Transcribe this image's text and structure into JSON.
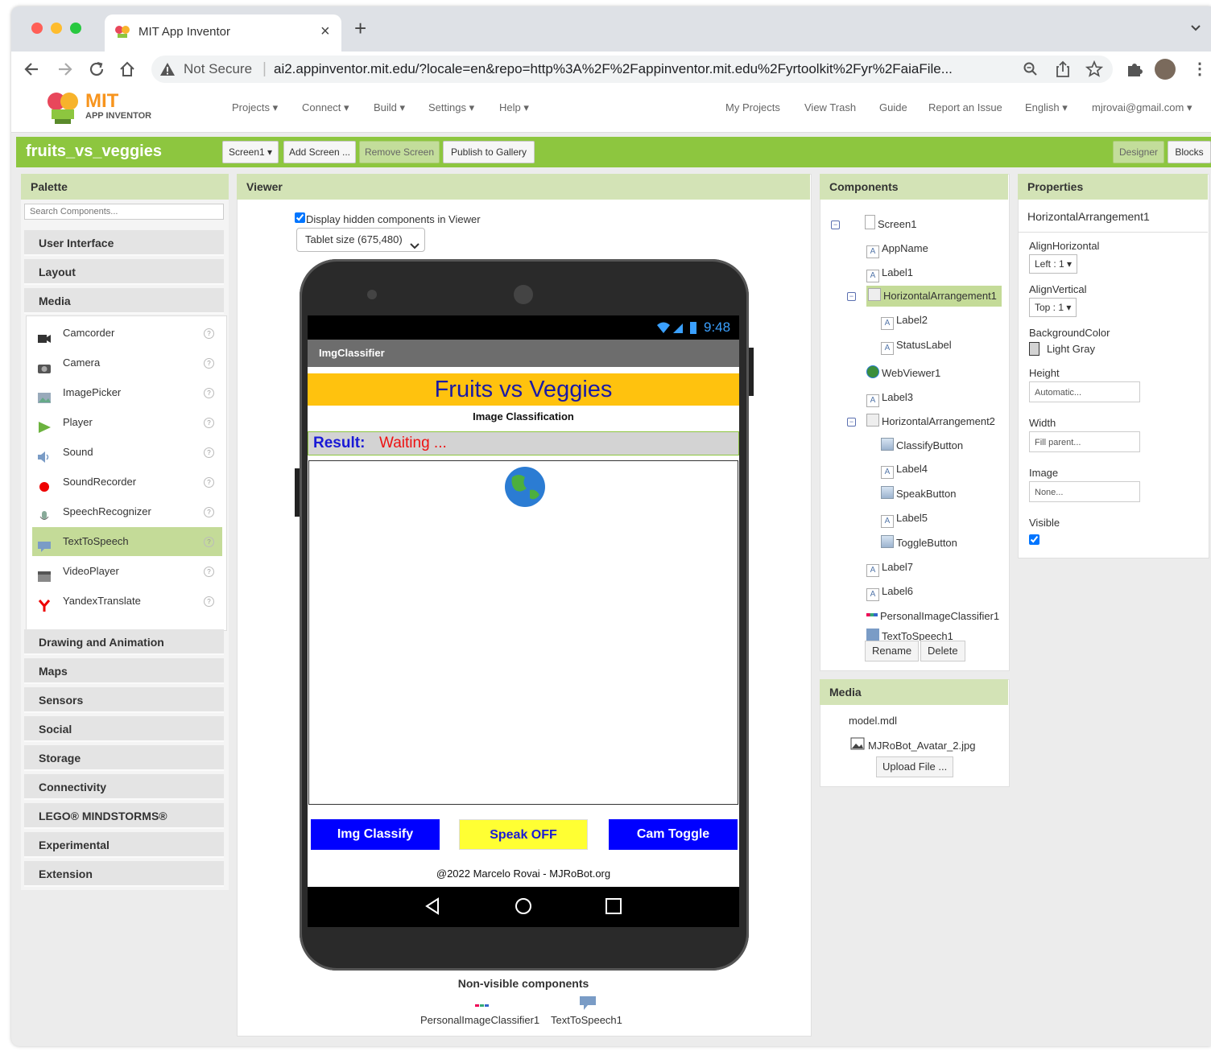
{
  "browser": {
    "tab_title": "MIT App Inventor",
    "tab_close": "×",
    "new_tab": "+",
    "security_label": "Not Secure",
    "url": "ai2.appinventor.mit.edu/?locale=en&repo=http%3A%2F%2Fappinventor.mit.edu%2Fyrtoolkit%2Fyr%2FaiaFile..."
  },
  "header": {
    "logo_mit": "MIT",
    "logo_sub": "APP INVENTOR",
    "menus": [
      "Projects ▾",
      "Connect ▾",
      "Build ▾",
      "Settings ▾",
      "Help ▾"
    ],
    "right_links": [
      "My Projects",
      "View Trash",
      "Guide",
      "Report an Issue",
      "English ▾",
      "mjrovai@gmail.com ▾"
    ]
  },
  "project": {
    "name": "fruits_vs_veggies",
    "screen_dropdown": "Screen1 ▾",
    "add_screen": "Add Screen ...",
    "remove_screen": "Remove Screen",
    "publish": "Publish to Gallery",
    "designer": "Designer",
    "blocks": "Blocks"
  },
  "palette": {
    "title": "Palette",
    "search_placeholder": "Search Components...",
    "categories_top": [
      "User Interface",
      "Layout",
      "Media"
    ],
    "media_items": [
      "Camcorder",
      "Camera",
      "ImagePicker",
      "Player",
      "Sound",
      "SoundRecorder",
      "SpeechRecognizer",
      "TextToSpeech",
      "VideoPlayer",
      "YandexTranslate"
    ],
    "selected_item": "TextToSpeech",
    "categories_bottom": [
      "Drawing and Animation",
      "Maps",
      "Sensors",
      "Social",
      "Storage",
      "Connectivity",
      "LEGO® MINDSTORMS®",
      "Experimental",
      "Extension"
    ],
    "help_glyph": "?"
  },
  "viewer": {
    "title": "Viewer",
    "hidden_checkbox_label": "Display hidden components in Viewer",
    "hidden_checked": true,
    "size_select": "Tablet size (675,480)",
    "phone": {
      "status_time": "9:48",
      "app_title": "ImgClassifier",
      "heading": "Fruits vs Veggies",
      "subheading": "Image Classification",
      "result_label": "Result:",
      "result_value": "Waiting ...",
      "buttons": [
        "Img Classify",
        "Speak OFF",
        "Cam Toggle"
      ],
      "footer": "@2022 Marcelo Rovai - MJRoBot.org",
      "nav": [
        "◁",
        "○",
        "□"
      ]
    },
    "nonvisible_title": "Non-visible components",
    "nonvisible_items": [
      "PersonalImageClassifier1",
      "TextToSpeech1"
    ]
  },
  "components": {
    "title": "Components",
    "tree": [
      {
        "name": "Screen1",
        "level": 0,
        "toggle": "⊟",
        "icon": "screen-icon"
      },
      {
        "name": "AppName",
        "level": 1,
        "icon": "label-icon"
      },
      {
        "name": "Label1",
        "level": 1,
        "icon": "label-icon"
      },
      {
        "name": "HorizontalArrangement1",
        "level": 1,
        "toggle": "⊟",
        "icon": "arrangement-icon",
        "selected": true
      },
      {
        "name": "Label2",
        "level": 2,
        "icon": "label-icon"
      },
      {
        "name": "StatusLabel",
        "level": 2,
        "icon": "label-icon"
      },
      {
        "name": "WebViewer1",
        "level": 1,
        "icon": "globe-icon"
      },
      {
        "name": "Label3",
        "level": 1,
        "icon": "label-icon"
      },
      {
        "name": "HorizontalArrangement2",
        "level": 1,
        "toggle": "⊟",
        "icon": "arrangement-icon"
      },
      {
        "name": "ClassifyButton",
        "level": 2,
        "icon": "button-icon"
      },
      {
        "name": "Label4",
        "level": 2,
        "icon": "label-icon"
      },
      {
        "name": "SpeakButton",
        "level": 2,
        "icon": "button-icon"
      },
      {
        "name": "Label5",
        "level": 2,
        "icon": "label-icon"
      },
      {
        "name": "ToggleButton",
        "level": 2,
        "icon": "button-icon"
      },
      {
        "name": "Label7",
        "level": 1,
        "icon": "label-icon"
      },
      {
        "name": "Label6",
        "level": 1,
        "icon": "label-icon"
      },
      {
        "name": "PersonalImageClassifier1",
        "level": 1,
        "icon": "classifier-icon"
      },
      {
        "name": "TextToSpeech1",
        "level": 1,
        "icon": "speech-icon"
      }
    ],
    "rename": "Rename",
    "delete": "Delete"
  },
  "media": {
    "title": "Media",
    "files": [
      "model.mdl",
      "MJRoBot_Avatar_2.jpg"
    ],
    "upload": "Upload File ..."
  },
  "properties": {
    "title": "Properties",
    "component": "HorizontalArrangement1",
    "align_h_label": "AlignHorizontal",
    "align_h_value": "Left : 1 ▾",
    "align_v_label": "AlignVertical",
    "align_v_value": "Top : 1 ▾",
    "bg_label": "BackgroundColor",
    "bg_value": "Light Gray",
    "height_label": "Height",
    "height_value": "Automatic...",
    "width_label": "Width",
    "width_value": "Fill parent...",
    "image_label": "Image",
    "image_value": "None...",
    "visible_label": "Visible",
    "visible_checked": true
  },
  "colors": {
    "green_bar": "#8dc63f",
    "panel_header": "#d3e3b6",
    "phone_heading_bg": "#ffc20e",
    "phone_blue": "#0000ff",
    "phone_yellow": "#ffff33"
  }
}
